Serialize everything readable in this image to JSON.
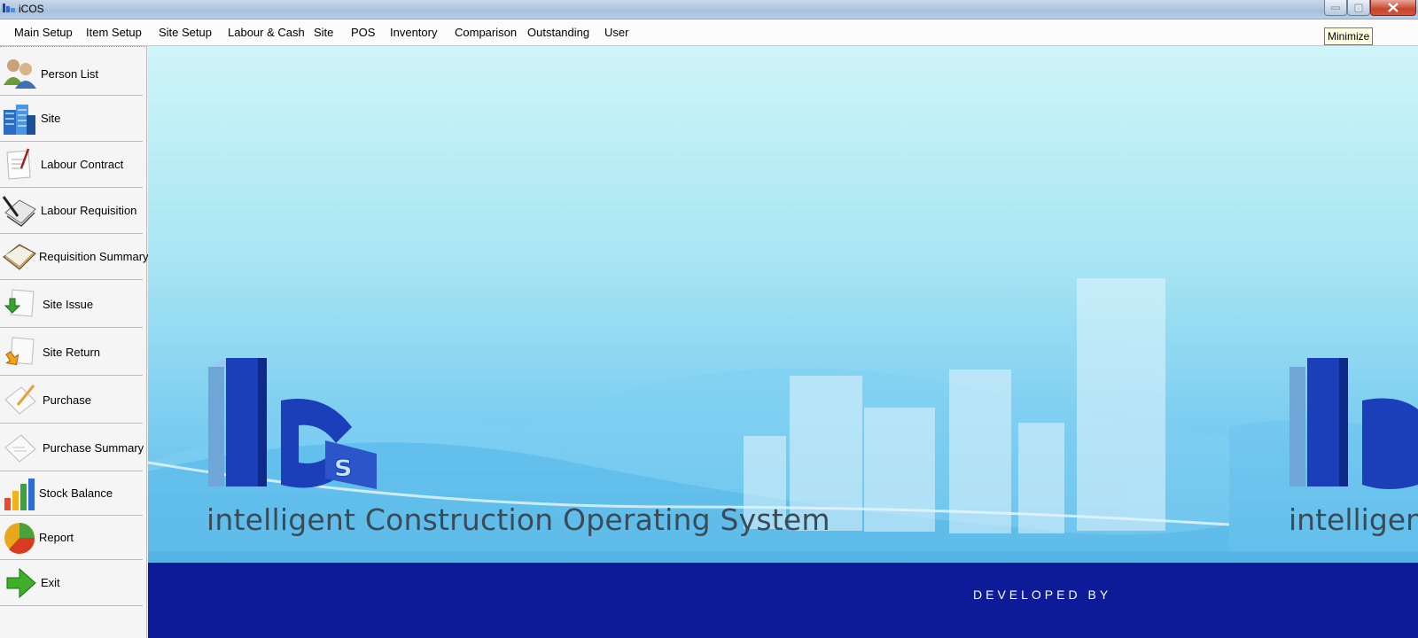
{
  "window": {
    "title": "iCOS",
    "minimize_tooltip": "Minimize"
  },
  "menu": [
    {
      "label": "Main Setup"
    },
    {
      "label": "Item Setup"
    },
    {
      "label": "Site Setup"
    },
    {
      "label": "Labour & Cash"
    },
    {
      "label": "Site"
    },
    {
      "label": "POS"
    },
    {
      "label": "Inventory"
    },
    {
      "label": "Comparison"
    },
    {
      "label": "Outstanding"
    },
    {
      "label": "User"
    }
  ],
  "sidebar": {
    "items": [
      {
        "label": "Person List",
        "icon": "person-list-icon"
      },
      {
        "label": "Site",
        "icon": "buildings-icon"
      },
      {
        "label": "Labour Contract",
        "icon": "contract-icon"
      },
      {
        "label": "Labour Requisition",
        "icon": "requisition-icon"
      },
      {
        "label": "Requisition Summary",
        "icon": "summary-book-icon"
      },
      {
        "label": "Site Issue",
        "icon": "site-issue-icon"
      },
      {
        "label": "Site Return",
        "icon": "site-return-icon"
      },
      {
        "label": "Purchase",
        "icon": "purchase-icon"
      },
      {
        "label": "Purchase Summary",
        "icon": "purchase-summary-icon"
      },
      {
        "label": "Stock Balance",
        "icon": "bar-chart-icon"
      },
      {
        "label": "Report",
        "icon": "pie-chart-icon"
      },
      {
        "label": "Exit",
        "icon": "exit-arrow-icon"
      }
    ]
  },
  "banner": {
    "tagline": "intelligent Construction Operating System",
    "tagline_repeat": "intelligen",
    "developed_by": "DEVELOPED BY",
    "colors": {
      "band": "#0d1b99",
      "logo_blue": "#1a3fb8"
    }
  }
}
